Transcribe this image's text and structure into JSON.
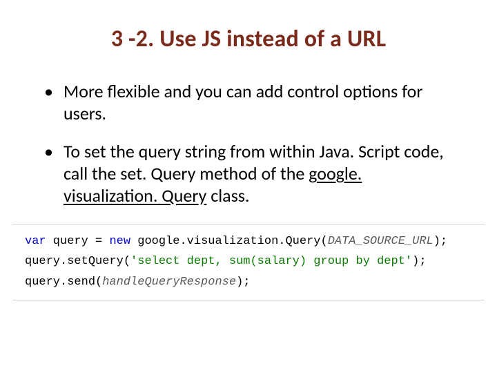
{
  "title": "3 -2. Use JS instead of a URL",
  "bullets": [
    "More flexible and you can add control options for users.",
    {
      "pre": "To set the query string from within Java. Script code, call the set. Query method of the ",
      "link": "google. visualization. Query",
      "post": " class."
    }
  ],
  "code": {
    "l1": {
      "kw": "var",
      "var": " query ",
      "op": "=",
      "sp": " ",
      "new": "new",
      "path": " google.visualization.",
      "cls": "Query",
      "arg": "DATA_SOURCE_URL"
    },
    "l2": {
      "obj": "query.",
      "m": "setQuery",
      "str": "'select dept, sum(salary) group by dept'"
    },
    "l3": {
      "obj": "query.",
      "m": "send",
      "arg": "handleQueryResponse"
    }
  }
}
